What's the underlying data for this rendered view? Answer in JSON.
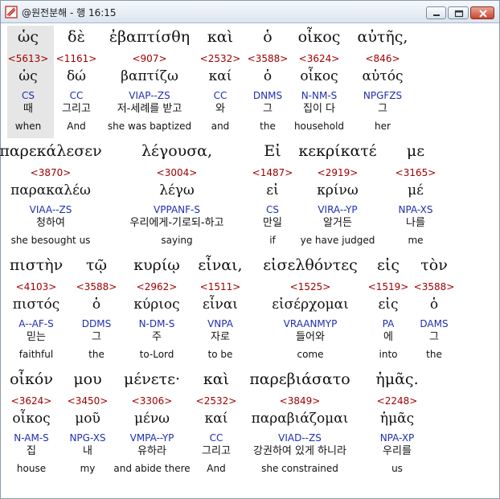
{
  "window": {
    "title": "@원전분해 - 행 16:15"
  },
  "verse": {
    "rows": [
      [
        {
          "greek": "ὡς",
          "strong": "<5613>",
          "lexeme": "ὡς",
          "parsing": "CS",
          "korean": "때",
          "english": "when"
        },
        {
          "greek": "δὲ",
          "strong": "<1161>",
          "lexeme": "δώ",
          "parsing": "CC",
          "korean": "그리고",
          "english": "And"
        },
        {
          "greek": "ἐβαπτίσθη",
          "strong": "<907>",
          "lexeme": "βαπτίζω",
          "parsing": "VIAP--ZS",
          "korean": "저-세례를 받고",
          "english": "she was baptized"
        },
        {
          "greek": "καὶ",
          "strong": "<2532>",
          "lexeme": "καί",
          "parsing": "CC",
          "korean": "와",
          "english": "and"
        },
        {
          "greek": "ὁ",
          "strong": "<3588>",
          "lexeme": "ὁ",
          "parsing": "DNMS",
          "korean": "그",
          "english": "the"
        },
        {
          "greek": "οἶκος",
          "strong": "<3624>",
          "lexeme": "οἶκος",
          "parsing": "N-NM-S",
          "korean": "집이 다",
          "english": "household"
        },
        {
          "greek": "αὐτῆς,",
          "strong": "<846>",
          "lexeme": "αὐτός",
          "parsing": "NPGFZS",
          "korean": "그",
          "english": "her"
        }
      ],
      [
        {
          "greek": "παρεκάλεσεν",
          "strong": "<3870>",
          "lexeme": "παρακαλέω",
          "parsing": "VIAA--ZS",
          "korean": "청하여",
          "english": "she besought us"
        },
        {
          "greek": "λέγουσα,",
          "strong": "<3004>",
          "lexeme": "λέγω",
          "parsing": "VPPANF-S",
          "korean": "우리에게-기로되-하고",
          "english": "saying"
        },
        {
          "greek": "Εἰ",
          "strong": "<1487>",
          "lexeme": "εἰ",
          "parsing": "CS",
          "korean": "만일",
          "english": "if"
        },
        {
          "greek": "κεκρίκατέ",
          "strong": "<2919>",
          "lexeme": "κρίνω",
          "parsing": "VIRA--YP",
          "korean": "알거든",
          "english": "ye have judged"
        },
        {
          "greek": "με",
          "strong": "<3165>",
          "lexeme": "μέ",
          "parsing": "NPA-XS",
          "korean": "나를",
          "english": "me"
        }
      ],
      [
        {
          "greek": "πιστὴν",
          "strong": "<4103>",
          "lexeme": "πιστός",
          "parsing": "A--AF-S",
          "korean": "믿는",
          "english": "faithful"
        },
        {
          "greek": "τῷ",
          "strong": "<3588>",
          "lexeme": "ὁ",
          "parsing": "DDMS",
          "korean": "그",
          "english": "the"
        },
        {
          "greek": "κυρίῳ",
          "strong": "<2962>",
          "lexeme": "κύριος",
          "parsing": "N-DM-S",
          "korean": "주",
          "english": "to-Lord"
        },
        {
          "greek": "εἶναι,",
          "strong": "<1511>",
          "lexeme": "εἶναι",
          "parsing": "VNPA",
          "korean": "자로",
          "english": "to be"
        },
        {
          "greek": "εἰσελθόντες",
          "strong": "<1525>",
          "lexeme": "εἰσέρχομαι",
          "parsing": "VRAANMYP",
          "korean": "들어와",
          "english": "come"
        },
        {
          "greek": "εἰς",
          "strong": "<1519>",
          "lexeme": "εἰς",
          "parsing": "PA",
          "korean": "에",
          "english": "into"
        },
        {
          "greek": "τὸν",
          "strong": "<3588>",
          "lexeme": "ὁ",
          "parsing": "DAMS",
          "korean": "그",
          "english": "the"
        }
      ],
      [
        {
          "greek": "οἶκόν",
          "strong": "<3624>",
          "lexeme": "οἶκος",
          "parsing": "N-AM-S",
          "korean": "집",
          "english": "house"
        },
        {
          "greek": "μου",
          "strong": "<3450>",
          "lexeme": "μοῦ",
          "parsing": "NPG-XS",
          "korean": "내",
          "english": "my"
        },
        {
          "greek": "μένετε·",
          "strong": "<3306>",
          "lexeme": "μένω",
          "parsing": "VMPA--YP",
          "korean": "유하라",
          "english": "and abide there"
        },
        {
          "greek": "καὶ",
          "strong": "<2532>",
          "lexeme": "καί",
          "parsing": "CC",
          "korean": "그리고",
          "english": "And"
        },
        {
          "greek": "παρεβιάσατο",
          "strong": "<3849>",
          "lexeme": "παραβιάζομαι",
          "parsing": "VIAD--ZS",
          "korean": "강권하여 있게 하니라",
          "english": "she constrained"
        },
        {
          "greek": "ἡμᾶς.",
          "strong": "<2248>",
          "lexeme": "ἡμᾶς",
          "parsing": "NPA-XP",
          "korean": "우리를",
          "english": "us"
        }
      ]
    ]
  }
}
